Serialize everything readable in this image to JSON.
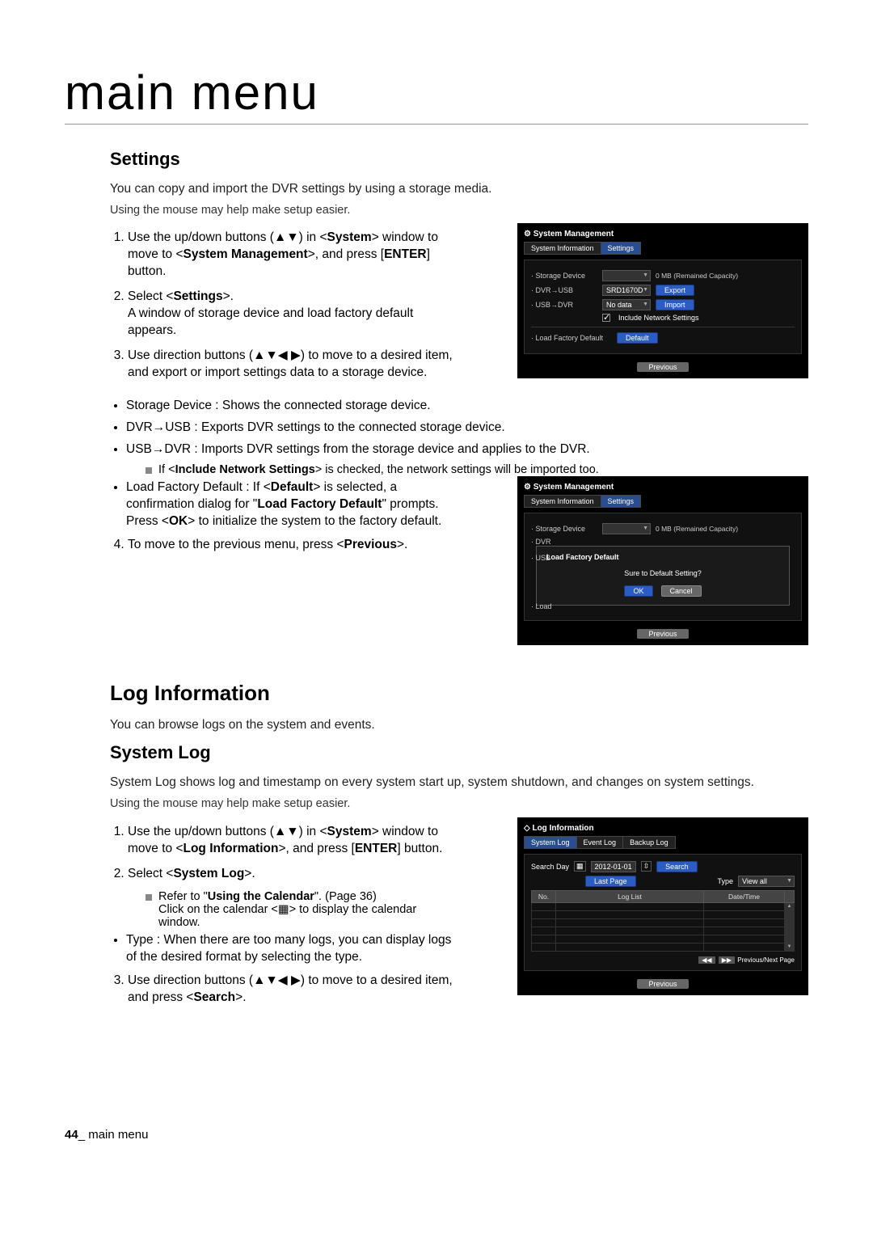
{
  "page": {
    "title": "main menu",
    "footer_page": "44",
    "footer_sep": "_",
    "footer_text": "main menu"
  },
  "settings": {
    "heading": "Settings",
    "intro": "You can copy and import the DVR settings by using a storage media.",
    "intro_note": "Using the mouse may help make setup easier.",
    "steps": [
      "Use the up/down buttons (▲▼) in <System> window to move to <System Management>, and press [ENTER] button.",
      "Select <Settings>.\nA window of storage device and load factory default appears.",
      "Use direction buttons (▲▼◀ ▶) to move to a desired item, and export or import settings data to a storage device."
    ],
    "bullets": [
      "Storage Device : Shows the connected storage device.",
      "DVR→USB : Exports DVR settings to the connected storage device.",
      "USB→DVR : Imports DVR settings from the storage device and applies to the DVR."
    ],
    "include_note": "If <Include Network Settings> is checked, the network settings will be imported too.",
    "bullets2": [
      "Load Factory Default : If <Default> is selected, a confirmation dialog for \"Load Factory Default\" prompts. Press <OK> to initialize the system to the factory default."
    ],
    "step4": "To move to the previous menu, press <Previous>."
  },
  "loginfo": {
    "heading": "Log Information",
    "intro": "You can browse logs on the system and events.",
    "syslog_heading": "System Log",
    "syslog_intro": "System Log shows log and timestamp on every system start up, system shutdown, and changes on system settings.",
    "syslog_note": "Using the mouse may help make setup easier.",
    "steps": [
      "Use the up/down buttons (▲▼) in <System> window to move to <Log Information>, and press [ENTER] button.",
      "Select <System Log>."
    ],
    "calendar_note": "Refer to \"Using the Calendar\". (Page 36)\nClick on the calendar <▦> to display the calendar window.",
    "bullets": [
      "Type : When there are too many logs, you can display logs of the desired format by selecting the type."
    ],
    "step3": "Use direction buttons (▲▼◀ ▶) to move to a desired item, and press <Search>."
  },
  "dvr1": {
    "title": "System Management",
    "tabs": [
      "System Information",
      "Settings"
    ],
    "storage_device_label": "· Storage Device",
    "capacity": "0 MB (Remained Capacity)",
    "dvr_to_usb_label": "· DVR→USB",
    "dvr_to_usb_value": "SRD1670D",
    "export_btn": "Export",
    "usb_to_dvr_label": "· USB→DVR",
    "usb_to_dvr_value": "No data",
    "import_btn": "Import",
    "include_label": "Include Network Settings",
    "load_factory_label": "· Load Factory Default",
    "default_btn": "Default",
    "previous": "Previous"
  },
  "dvr2": {
    "title": "System Management",
    "tabs": [
      "System Information",
      "Settings"
    ],
    "storage_device_label": "· Storage Device",
    "capacity": "0 MB (Remained Capacity)",
    "dvr_label": "· DVR",
    "usb_label": "· USB",
    "load_label": "· Load",
    "modal_title": "Load Factory Default",
    "modal_msg": "Sure to Default Setting?",
    "ok": "OK",
    "cancel": "Cancel",
    "previous": "Previous"
  },
  "dvr3": {
    "title": "Log Information",
    "tabs": [
      "System Log",
      "Event Log",
      "Backup Log"
    ],
    "search_day_label": "Search Day",
    "date": "2012-01-01",
    "search_btn": "Search",
    "last_page_btn": "Last Page",
    "type_label": "Type",
    "type_value": "View all",
    "col_no": "No.",
    "col_loglist": "Log List",
    "col_datetime": "Date/Time",
    "pager_label": "Previous/Next Page",
    "previous": "Previous"
  }
}
